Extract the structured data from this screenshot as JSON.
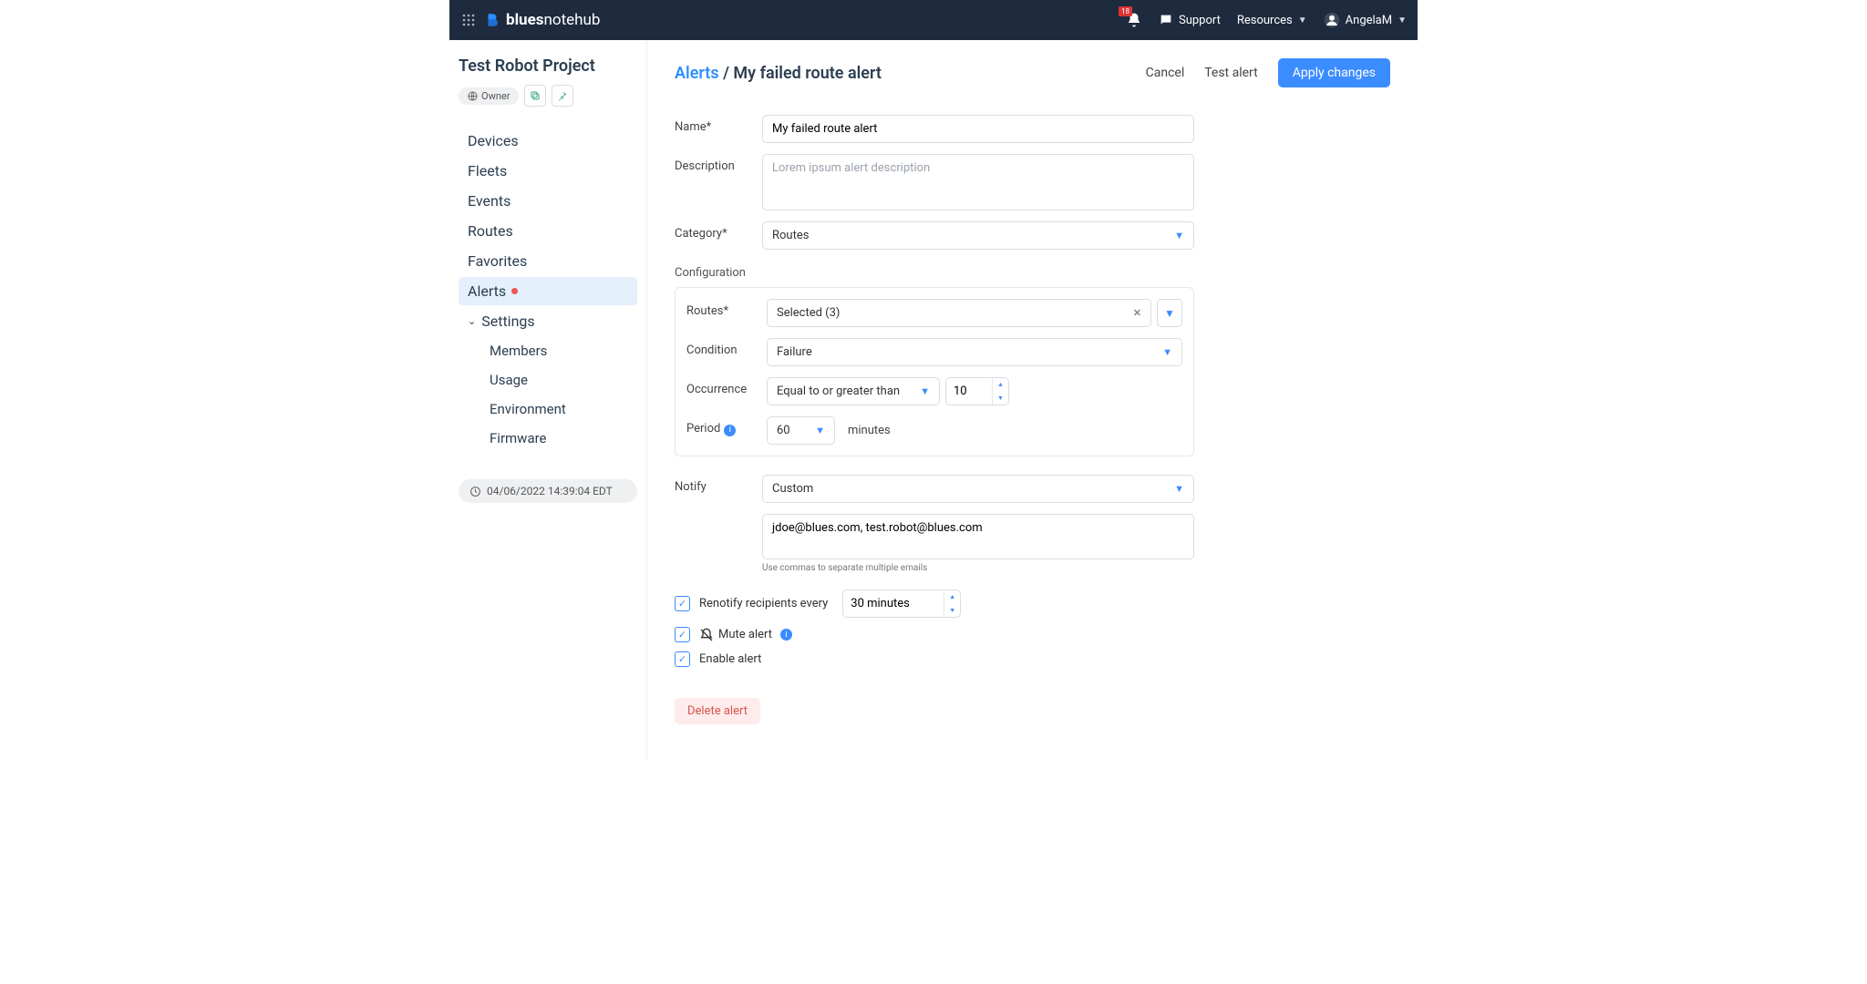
{
  "header": {
    "brand_bold": "blues",
    "brand_light": "notehub",
    "badge": "18",
    "support": "Support",
    "resources": "Resources",
    "user": "AngelaM"
  },
  "sidebar": {
    "project": "Test Robot Project",
    "owner_label": "Owner",
    "nav": {
      "devices": "Devices",
      "fleets": "Fleets",
      "events": "Events",
      "routes": "Routes",
      "favorites": "Favorites",
      "alerts": "Alerts",
      "settings": "Settings",
      "members": "Members",
      "usage": "Usage",
      "environment": "Environment",
      "firmware": "Firmware"
    },
    "timestamp": "04/06/2022 14:39:04 EDT"
  },
  "breadcrumb": {
    "root": "Alerts",
    "sep": " / ",
    "page": "My failed route alert"
  },
  "actions": {
    "cancel": "Cancel",
    "test": "Test alert",
    "apply": "Apply changes"
  },
  "form": {
    "name_label": "Name*",
    "name_value": "My failed route alert",
    "desc_label": "Description",
    "desc_placeholder": "Lorem ipsum alert description",
    "category_label": "Category*",
    "category_value": "Routes",
    "config_label": "Configuration",
    "routes_label": "Routes*",
    "routes_value": "Selected (3)",
    "condition_label": "Condition",
    "condition_value": "Failure",
    "occurrence_label": "Occurrence",
    "occurrence_op": "Equal to or greater than",
    "occurrence_num": "10",
    "period_label": "Period",
    "period_value": "60",
    "period_unit": "minutes",
    "notify_label": "Notify",
    "notify_value": "Custom",
    "notify_emails": "jdoe@blues.com, test.robot@blues.com",
    "notify_help": "Use commas to separate multiple emails",
    "renotify_label": "Renotify recipients every",
    "renotify_value": "30 minutes",
    "mute_label": "Mute alert",
    "enable_label": "Enable alert",
    "delete": "Delete alert"
  }
}
